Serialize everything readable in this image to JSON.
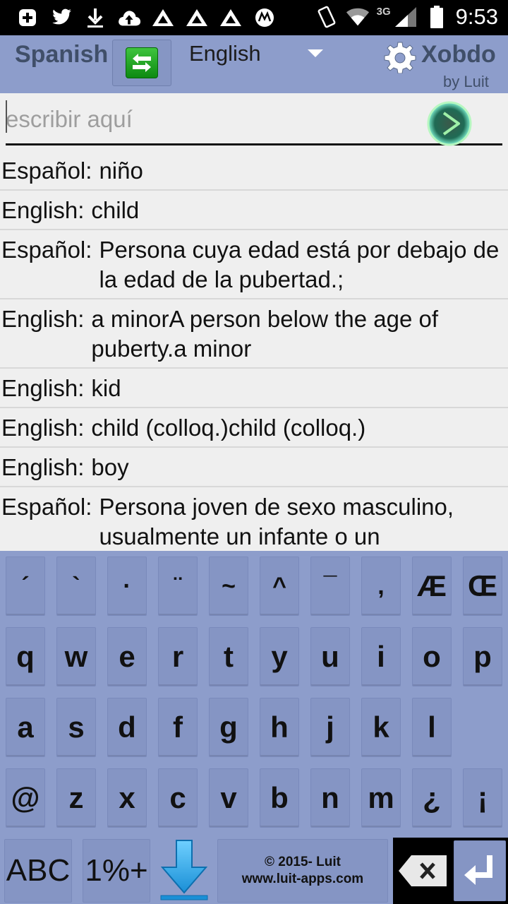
{
  "status_bar": {
    "time": "9:53",
    "network_label": "3G",
    "icons_left": [
      "plus-box-icon",
      "twitter-icon",
      "download-icon",
      "cloud-upload-icon",
      "triangle-app-icon",
      "triangle-app-icon",
      "triangle-app-icon",
      "motorola-icon"
    ],
    "icons_right": [
      "vibrate-icon",
      "wifi-icon",
      "signal-icon",
      "battery-icon"
    ]
  },
  "header": {
    "source_language": "Spanish",
    "target_language": "English",
    "brand": "Xobdo",
    "brand_sub": "by Luit"
  },
  "search": {
    "placeholder": "escribir aquí",
    "value": ""
  },
  "results": [
    {
      "label": "Español:",
      "text": "niño"
    },
    {
      "label": "English:",
      "text": "child"
    },
    {
      "label": "Español:",
      "text": "Persona cuya edad está por debajo de la edad de la pubertad.;"
    },
    {
      "label": "English:",
      "text": "a minorA person below the age of puberty.a minor"
    },
    {
      "label": "English:",
      "text": "kid"
    },
    {
      "label": "English:",
      "text": "child (colloq.)child (colloq.)"
    },
    {
      "label": "English:",
      "text": "boy"
    },
    {
      "label": "Español:",
      "text": "Persona joven de sexo masculino, usualmente un infante o un adolescente.;"
    }
  ],
  "keyboard": {
    "rows": [
      [
        "´",
        "`",
        "·",
        "¨",
        "~",
        "^",
        "¯",
        ",",
        "Æ",
        "Œ"
      ],
      [
        "q",
        "w",
        "e",
        "r",
        "t",
        "y",
        "u",
        "i",
        "o",
        "p"
      ],
      [
        "a",
        "s",
        "d",
        "f",
        "g",
        "h",
        "j",
        "k",
        "l"
      ],
      [
        "@",
        "z",
        "x",
        "c",
        "v",
        "b",
        "n",
        "m",
        "¿",
        "¡"
      ]
    ],
    "abc_label": "ABC",
    "symbols_label": "1%+",
    "credit_line1": "© 2015- Luit",
    "credit_line2": "www.luit-apps.com"
  },
  "colors": {
    "header_bg": "#8d9dcb",
    "header_text": "#404f69",
    "keyboard_bg": "#8d9dcb",
    "key_bg": "#8595c4",
    "swap_green": "#1aa31e",
    "hide_arrow": "#2aa3e0"
  }
}
